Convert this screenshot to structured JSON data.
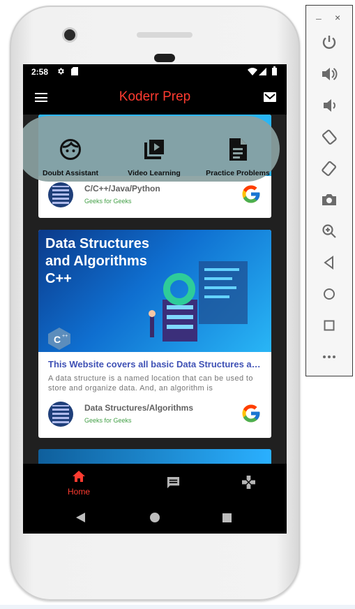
{
  "status": {
    "time": "2:58"
  },
  "appbar": {
    "title": "Koderr Prep"
  },
  "quick_actions": [
    {
      "label": "Doubt Assistant",
      "icon": "face-icon"
    },
    {
      "label": "Video Learning",
      "icon": "video-library-icon"
    },
    {
      "label": "Practice Problems",
      "icon": "document-icon"
    }
  ],
  "cards": [
    {
      "category": "C/C++/Java/Python",
      "source": "Geeks for Geeks"
    },
    {
      "banner_title": "Data Structures\nand Algorithms\nC++",
      "headline": "This Website covers all basic Data Structures and Algorithms",
      "description": "A data structure is a named location that can be used to store and organize data. And, an algorithm is",
      "category": "Data Structures/Algorithms",
      "source": "Geeks for Geeks"
    }
  ],
  "bottom_nav": {
    "home_label": "Home"
  },
  "colors": {
    "accent": "#ff3b30",
    "headline": "#3f51b5",
    "source": "#43a047"
  }
}
